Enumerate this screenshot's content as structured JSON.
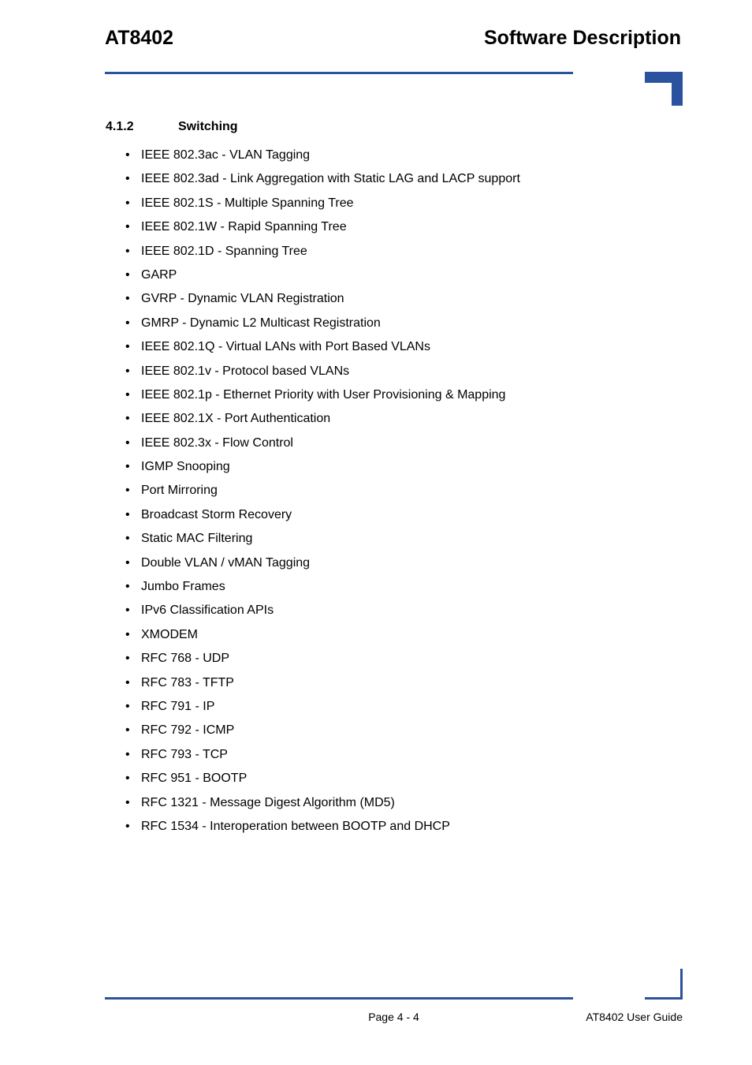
{
  "header": {
    "left_title": "AT8402",
    "right_title": "Software Description",
    "accent_color": "#2b529f",
    "corner_icon": "corner-bracket-top-right-icon"
  },
  "section": {
    "number": "4.1.2",
    "title": "Switching"
  },
  "bullet_char": "•",
  "features": [
    "IEEE 802.3ac - VLAN Tagging",
    "IEEE 802.3ad - Link Aggregation with Static LAG and LACP support",
    "IEEE 802.1S - Multiple Spanning Tree",
    "IEEE 802.1W - Rapid Spanning Tree",
    "IEEE 802.1D - Spanning Tree",
    "GARP",
    "GVRP - Dynamic VLAN Registration",
    "GMRP - Dynamic L2 Multicast Registration",
    "IEEE 802.1Q - Virtual LANs with Port Based VLANs",
    "IEEE 802.1v - Protocol based VLANs",
    "IEEE 802.1p - Ethernet Priority with User Provisioning & Mapping",
    "IEEE 802.1X - Port Authentication",
    "IEEE 802.3x - Flow Control",
    "IGMP Snooping",
    "Port Mirroring",
    "Broadcast Storm Recovery",
    "Static MAC Filtering",
    "Double VLAN / vMAN Tagging",
    "Jumbo Frames",
    "IPv6 Classification APIs",
    "XMODEM",
    "RFC 768 - UDP",
    "RFC 783 - TFTP",
    "RFC 791 - IP",
    "RFC 792 - ICMP",
    "RFC 793 - TCP",
    "RFC 951 - BOOTP",
    "RFC 1321 - Message Digest Algorithm (MD5)",
    "RFC 1534 - Interoperation between BOOTP and DHCP"
  ],
  "footer": {
    "page_label": "Page 4 - 4",
    "guide_label": "AT8402 User Guide",
    "corner_icon": "corner-bracket-bottom-right-icon"
  }
}
